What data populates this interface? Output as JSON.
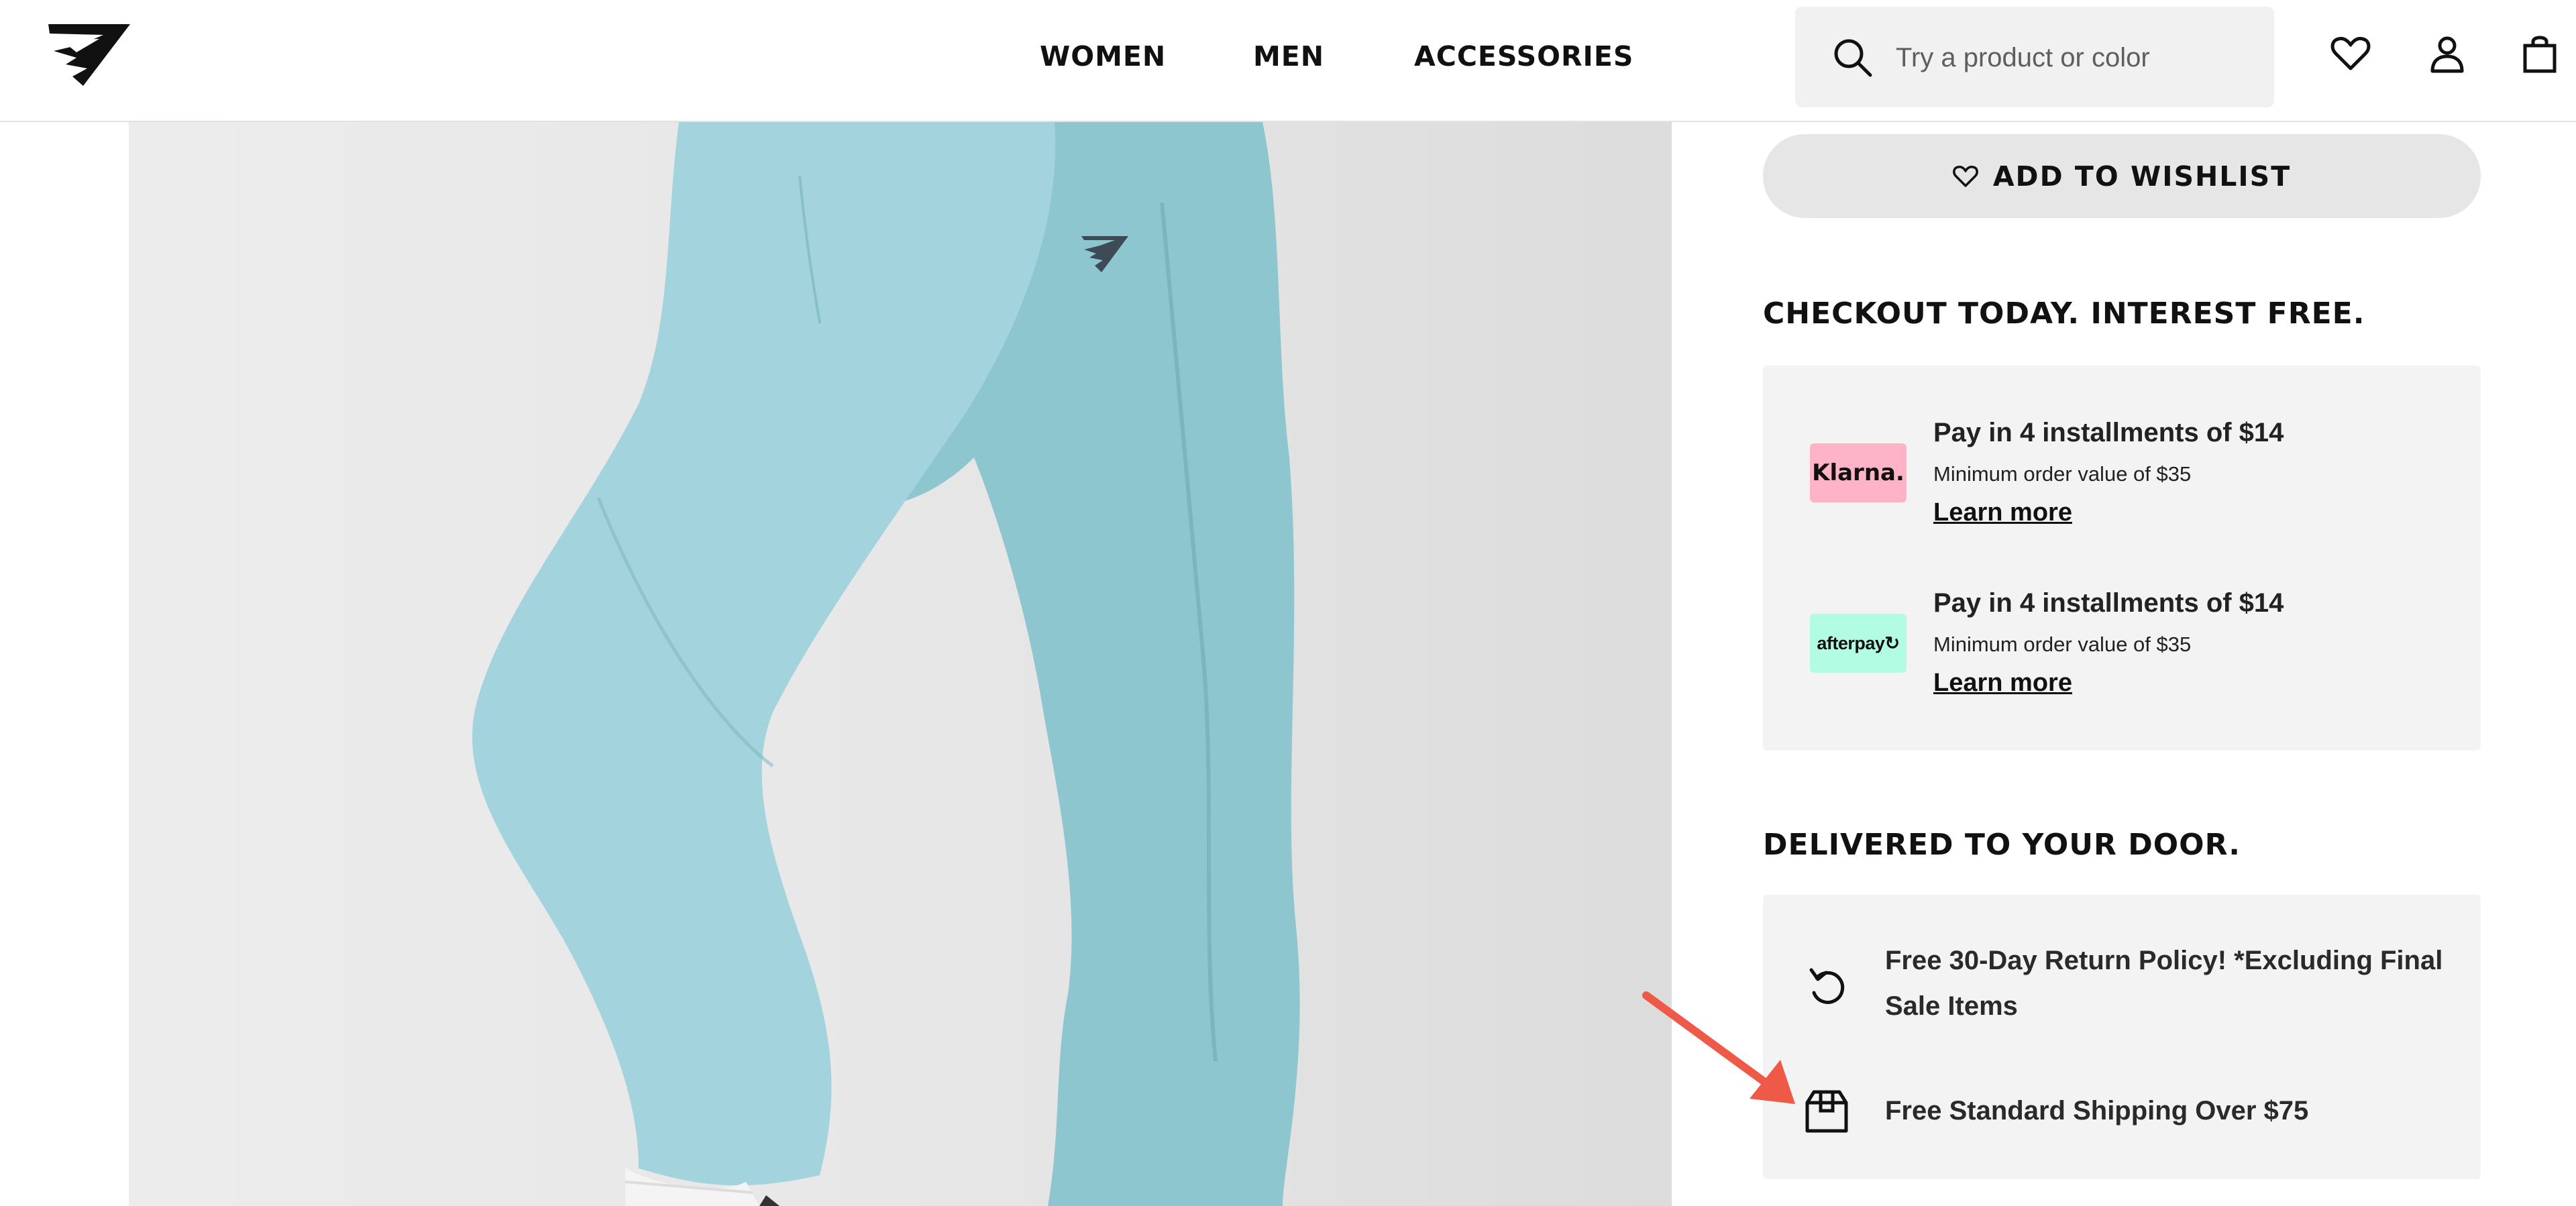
{
  "header": {
    "nav": [
      "WOMEN",
      "MEN",
      "ACCESSORIES"
    ],
    "search": {
      "placeholder": "Try a product or color"
    },
    "icons": [
      "search-icon",
      "heart-icon",
      "user-icon",
      "bag-icon"
    ]
  },
  "product": {
    "wishlist_label": "ADD TO WISHLIST"
  },
  "checkout": {
    "title": "CHECKOUT TODAY. INTEREST FREE.",
    "options": [
      {
        "provider": "Klarna.",
        "title": "Pay in 4 installments of $14",
        "min": "Minimum order value of $35",
        "link": "Learn more"
      },
      {
        "provider": "afterpay",
        "title": "Pay in 4 installments of $14",
        "min": "Minimum order value of $35",
        "link": "Learn more"
      }
    ]
  },
  "delivery": {
    "title": "DELIVERED TO YOUR DOOR.",
    "items": [
      {
        "icon": "return-icon",
        "text": "Free 30-Day Return Policy! *Excluding Final Sale Items"
      },
      {
        "icon": "box-icon",
        "text": "Free Standard Shipping Over $75"
      }
    ]
  },
  "colors": {
    "klarna": "#ffb3c7",
    "afterpay": "#b2fce4",
    "pants": "#9ccfd8",
    "annotation_arrow": "#ee5a47"
  }
}
